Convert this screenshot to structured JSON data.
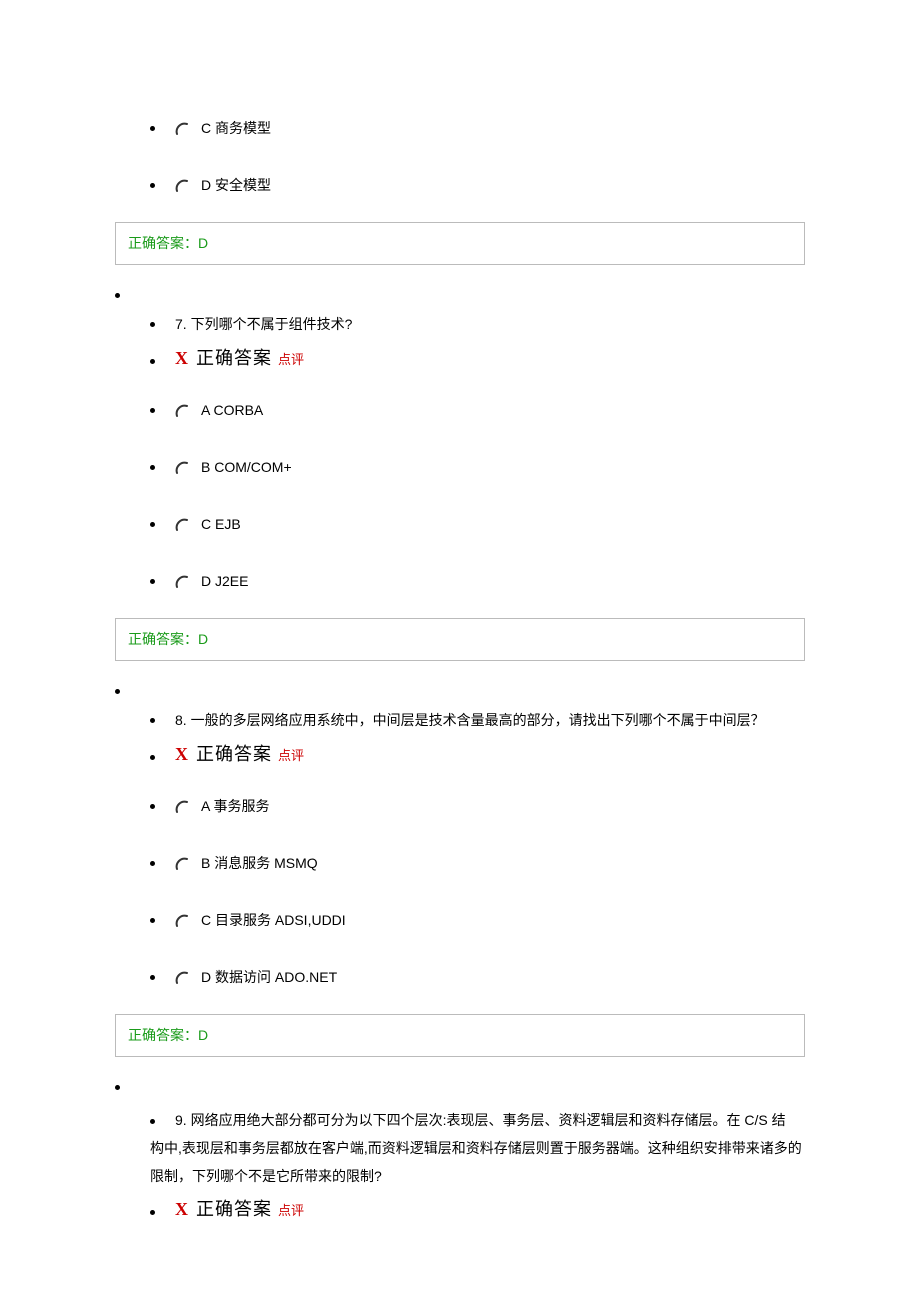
{
  "q6": {
    "optC": "C 商务模型",
    "optD": "D 安全模型",
    "answerLabel": "正确答案：D"
  },
  "q7": {
    "text": "7. 下列哪个不属于组件技术?",
    "x": "X",
    "zq": "正确答案",
    "dp": "点评",
    "optA": "A CORBA",
    "optB": "B COM/COM+",
    "optC": "C EJB",
    "optD": "D J2EE",
    "answerLabel": "正确答案：D"
  },
  "q8": {
    "text": "8. 一般的多层网络应用系统中，中间层是技术含量最高的部分，请找出下列哪个不属于中间层？",
    "x": "X",
    "zq": "正确答案",
    "dp": "点评",
    "optA": "A 事务服务",
    "optB": "B 消息服务 MSMQ",
    "optC": "C 目录服务 ADSI,UDDI",
    "optD": "D 数据访问 ADO.NET",
    "answerLabel": "正确答案：D"
  },
  "q9": {
    "text1": "9. 网络应用绝大部分都可分为以下四个层次:表现层、事务层、资料逻辑层和资料存储层。在 C/S 结",
    "text2": "构中,表现层和事务层都放在客户端,而资料逻辑层和资料存储层则置于服务器端。这种组织安排带来诸多的",
    "text3": "限制，下列哪个不是它所带来的限制?",
    "x": "X",
    "zq": "正确答案",
    "dp": "点评"
  }
}
